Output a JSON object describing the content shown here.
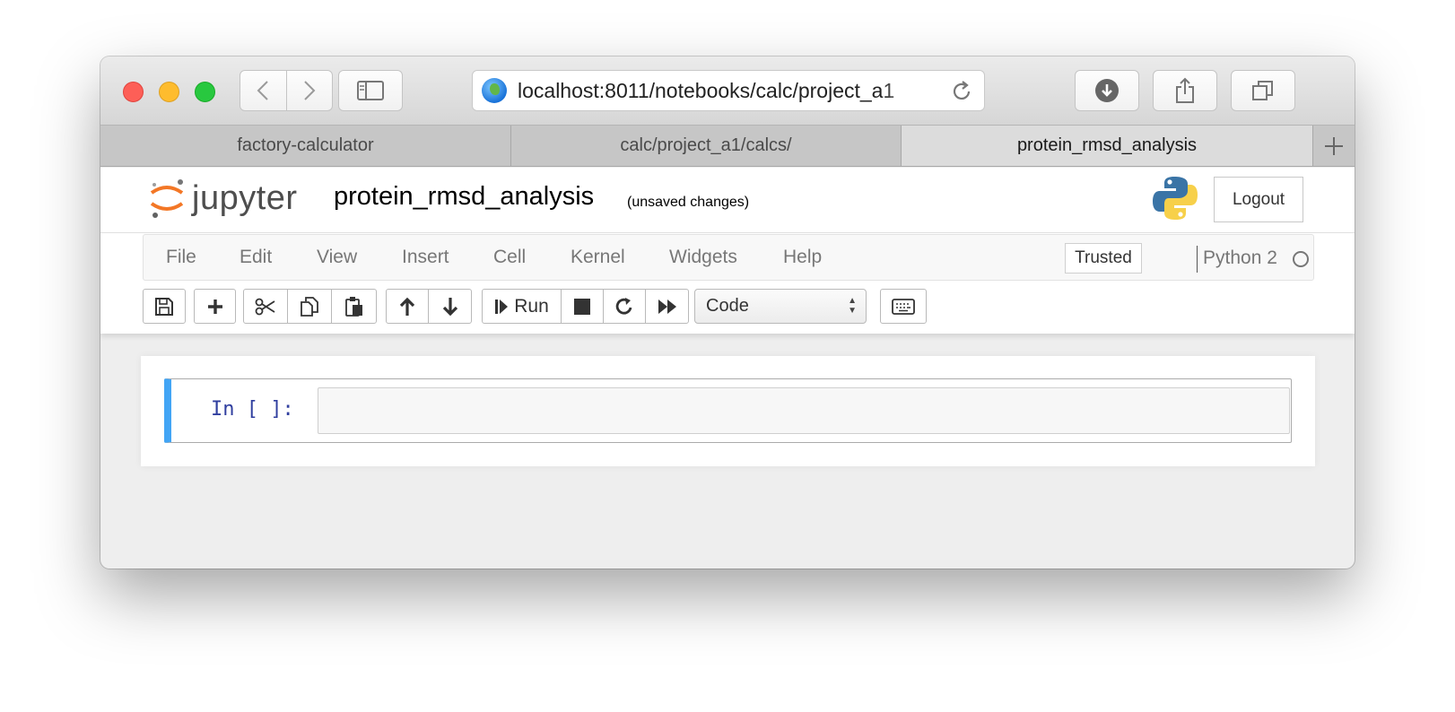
{
  "browser": {
    "url": "localhost:8011/notebooks/calc/project_a1",
    "tabs": [
      {
        "label": "factory-calculator",
        "active": false
      },
      {
        "label": "calc/project_a1/calcs/",
        "active": false
      },
      {
        "label": "protein_rmsd_analysis",
        "active": true
      }
    ]
  },
  "header": {
    "logo_text": "jupyter",
    "notebook_name": "protein_rmsd_analysis",
    "save_status": "(unsaved changes)",
    "logout_label": "Logout"
  },
  "menu": {
    "items": [
      "File",
      "Edit",
      "View",
      "Insert",
      "Cell",
      "Kernel",
      "Widgets",
      "Help"
    ],
    "trusted_label": "Trusted",
    "kernel_name": "Python 2"
  },
  "toolbar": {
    "run_label": "Run",
    "cell_type": "Code"
  },
  "notebook": {
    "cells": [
      {
        "prompt": "In [ ]:",
        "source": ""
      }
    ]
  },
  "colors": {
    "accent": "#42a5f5",
    "prompt": "#303f9f",
    "jupyter_orange": "#f37726"
  }
}
